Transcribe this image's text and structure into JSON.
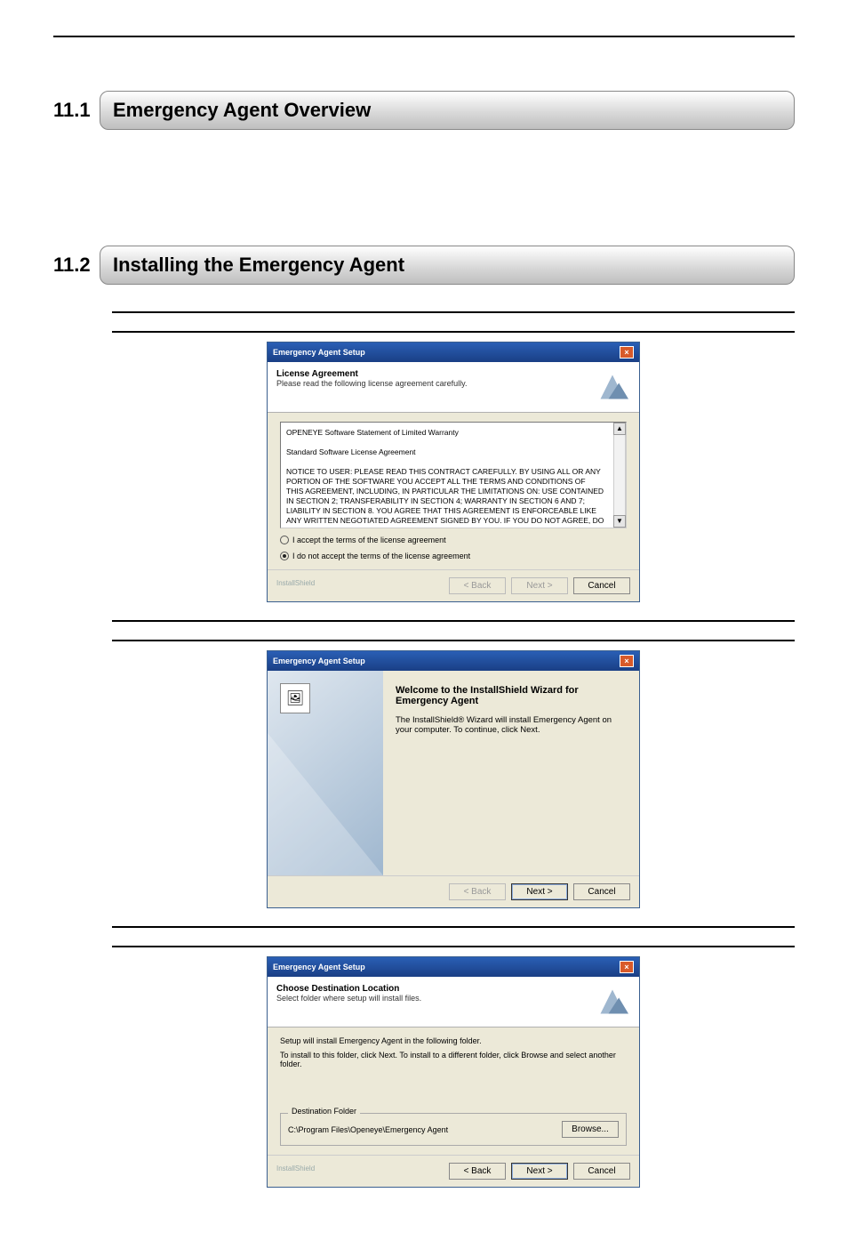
{
  "sections": {
    "s1": {
      "num": "11.1",
      "title": "Emergency Agent Overview"
    },
    "s2": {
      "num": "11.2",
      "title": "Installing the Emergency Agent"
    }
  },
  "dialog_title": "Emergency Agent Setup",
  "close_glyph": "×",
  "brand": "InstallShield",
  "buttons": {
    "back": "< Back",
    "next": "Next >",
    "cancel": "Cancel",
    "browse": "Browse..."
  },
  "license": {
    "header_title": "License Agreement",
    "header_sub": "Please read the following license agreement carefully.",
    "line1": "OPENEYE Software Statement of Limited Warranty",
    "line2": "Standard Software License Agreement",
    "body": "NOTICE TO USER: PLEASE READ THIS CONTRACT CAREFULLY. BY USING ALL OR ANY PORTION OF THE SOFTWARE YOU ACCEPT ALL THE TERMS AND CONDITIONS OF THIS AGREEMENT, INCLUDING, IN PARTICULAR THE LIMITATIONS ON: USE CONTAINED IN SECTION 2; TRANSFERABILITY IN SECTION 4; WARRANTY IN SECTION 6 AND 7; LIABILITY IN SECTION 8. YOU AGREE THAT THIS AGREEMENT IS ENFORCEABLE LIKE ANY WRITTEN NEGOTIATED AGREEMENT SIGNED BY YOU. IF YOU DO NOT AGREE, DO NOT USE THIS",
    "accept": "I accept the terms of the license agreement",
    "reject": "I do not accept the terms of the license agreement"
  },
  "welcome": {
    "title": "Welcome to the InstallShield Wizard for Emergency Agent",
    "text": "The InstallShield® Wizard will install Emergency Agent on your computer. To continue, click Next.",
    "pic_glyph": "🖼"
  },
  "dest": {
    "header_title": "Choose Destination Location",
    "header_sub": "Select folder where setup will install files.",
    "line1": "Setup will install Emergency Agent in the following folder.",
    "line2": "To install to this folder, click Next. To install to a different folder, click Browse and select another folder.",
    "legend": "Destination Folder",
    "path": "C:\\Program Files\\Openeye\\Emergency Agent"
  },
  "scroll": {
    "up": "▲",
    "down": "▼"
  }
}
